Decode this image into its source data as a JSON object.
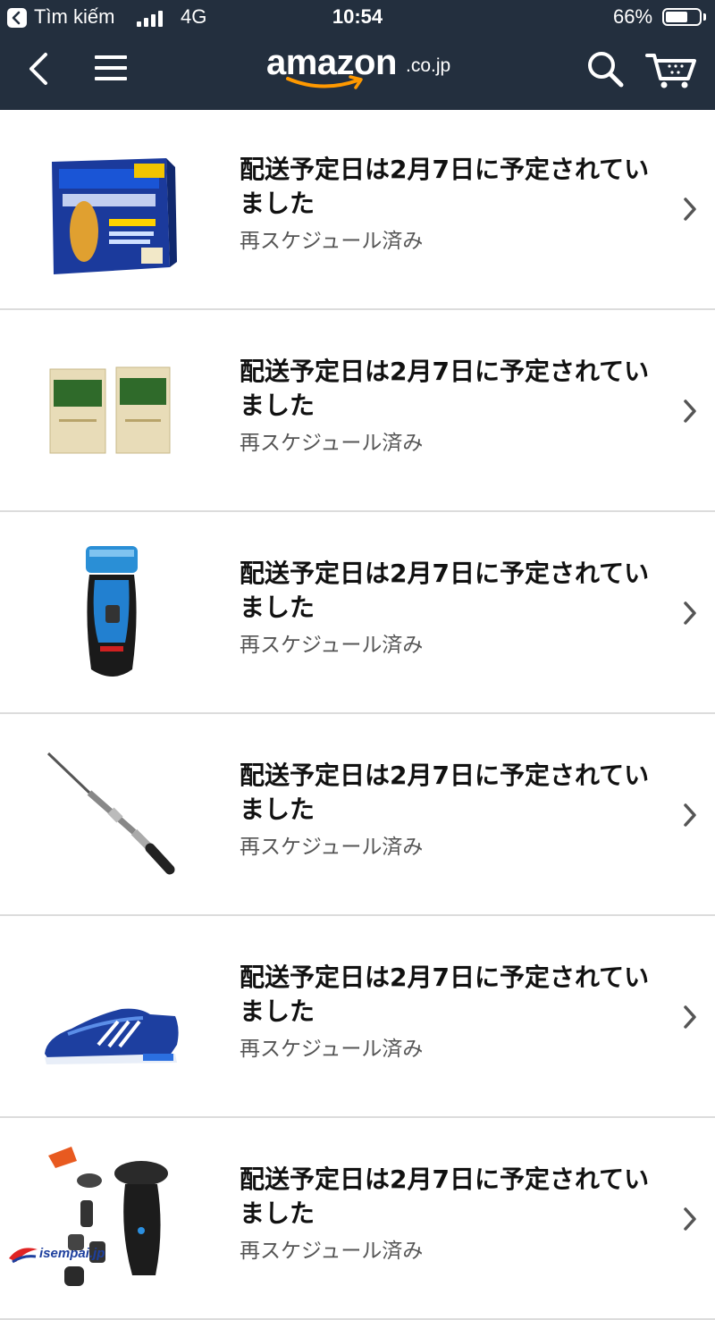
{
  "status_bar": {
    "back_app_label": "Tìm kiếm",
    "network": "4G",
    "time": "10:54",
    "battery_percent": "66%",
    "battery_level": 0.66
  },
  "header": {
    "logo_text": "amazon",
    "logo_tld": ".co.jp",
    "icons": [
      "back-icon",
      "menu-icon",
      "search-icon",
      "cart-icon"
    ]
  },
  "orders": [
    {
      "title": "配送予定日は2月7日に予定されていました",
      "status": "再スケジュール済み",
      "thumbnail": "glucosamine-box"
    },
    {
      "title": "配送予定日は2月7日に予定されていました",
      "status": "再スケジュール済み",
      "thumbnail": "spirulina-bottles"
    },
    {
      "title": "配送予定日は2月7日に予定されていました",
      "status": "再スケジュール済み",
      "thumbnail": "blue-shaver"
    },
    {
      "title": "配送予定日は2月7日に予定されていました",
      "status": "再スケジュール済み",
      "thumbnail": "fishing-rod"
    },
    {
      "title": "配送予定日は2月7日に予定されていました",
      "status": "再スケジュール済み",
      "thumbnail": "blue-sneaker"
    },
    {
      "title": "配送予定日は2月7日に予定されていました",
      "status": "再スケジュール済み",
      "thumbnail": "shaver-kit"
    }
  ],
  "watermark": {
    "text": "isempai.jp"
  },
  "colors": {
    "header_bg": "#232f3e",
    "smile": "#ff9900",
    "divider": "#dcdcdc",
    "chevron": "#555555"
  }
}
